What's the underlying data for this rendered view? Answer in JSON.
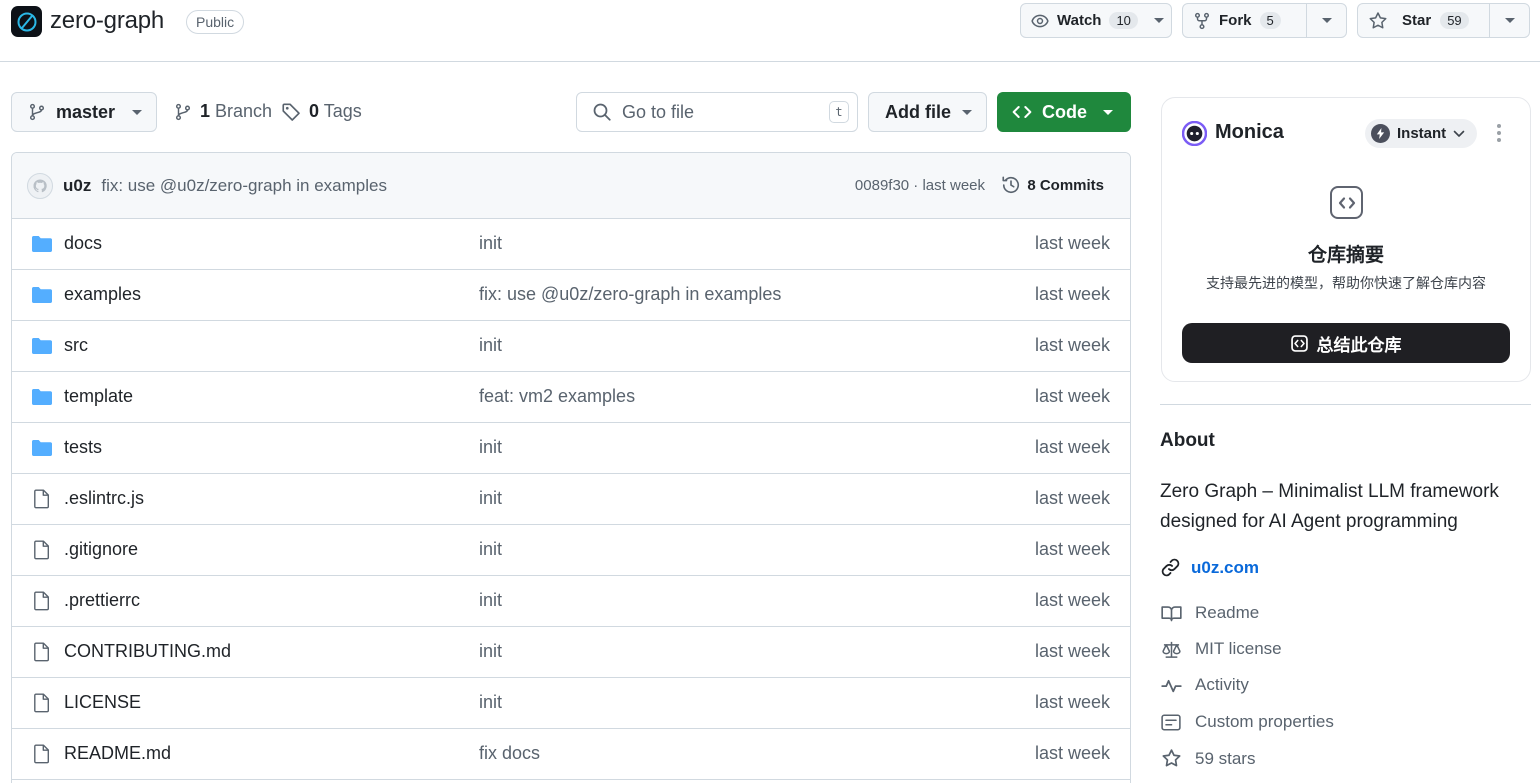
{
  "repo": {
    "name": "zero-graph",
    "visibility": "Public"
  },
  "actions": {
    "watch": {
      "label": "Watch",
      "count": "10"
    },
    "fork": {
      "label": "Fork",
      "count": "5"
    },
    "star": {
      "label": "Star",
      "count": "59"
    }
  },
  "branch_bar": {
    "branch": "master",
    "branches_count": "1",
    "branches_label": "Branch",
    "tags_count": "0",
    "tags_label": "Tags",
    "goto_placeholder": "Go to file",
    "goto_shortcut": "t",
    "add_file": "Add file",
    "code": "Code"
  },
  "latest_commit": {
    "author": "u0z",
    "message": "fix: use @u0z/zero-graph in examples",
    "meta": "0089f30 · last week",
    "commits": "8 Commits"
  },
  "files": [
    {
      "type": "dir",
      "name": "docs",
      "message": "init",
      "date": "last week"
    },
    {
      "type": "dir",
      "name": "examples",
      "message": "fix: use @u0z/zero-graph in examples",
      "date": "last week"
    },
    {
      "type": "dir",
      "name": "src",
      "message": "init",
      "date": "last week"
    },
    {
      "type": "dir",
      "name": "template",
      "message": "feat: vm2 examples",
      "date": "last week"
    },
    {
      "type": "dir",
      "name": "tests",
      "message": "init",
      "date": "last week"
    },
    {
      "type": "file",
      "name": ".eslintrc.js",
      "message": "init",
      "date": "last week"
    },
    {
      "type": "file",
      "name": ".gitignore",
      "message": "init",
      "date": "last week"
    },
    {
      "type": "file",
      "name": ".prettierrc",
      "message": "init",
      "date": "last week"
    },
    {
      "type": "file",
      "name": "CONTRIBUTING.md",
      "message": "init",
      "date": "last week"
    },
    {
      "type": "file",
      "name": "LICENSE",
      "message": "init",
      "date": "last week"
    },
    {
      "type": "file",
      "name": "README.md",
      "message": "fix docs",
      "date": "last week"
    }
  ],
  "monica": {
    "name": "Monica",
    "mode": "Instant",
    "title": "仓库摘要",
    "subtitle": "支持最先进的模型，帮助你快速了解仓库内容",
    "button": "总结此仓库"
  },
  "about": {
    "heading": "About",
    "description": "Zero Graph – Minimalist LLM framework designed for AI Agent programming",
    "website": "u0z.com",
    "items": [
      {
        "icon": "book-icon",
        "label": "Readme"
      },
      {
        "icon": "scale-icon",
        "label": "MIT license"
      },
      {
        "icon": "pulse-icon",
        "label": "Activity"
      },
      {
        "icon": "note-icon",
        "label": "Custom properties"
      },
      {
        "icon": "star-icon",
        "label": "59 stars"
      }
    ]
  },
  "colors": {
    "accent_green": "#1f883d",
    "link_blue": "#0969da",
    "folder_blue": "#54aeff",
    "border": "#d1d9e0"
  }
}
